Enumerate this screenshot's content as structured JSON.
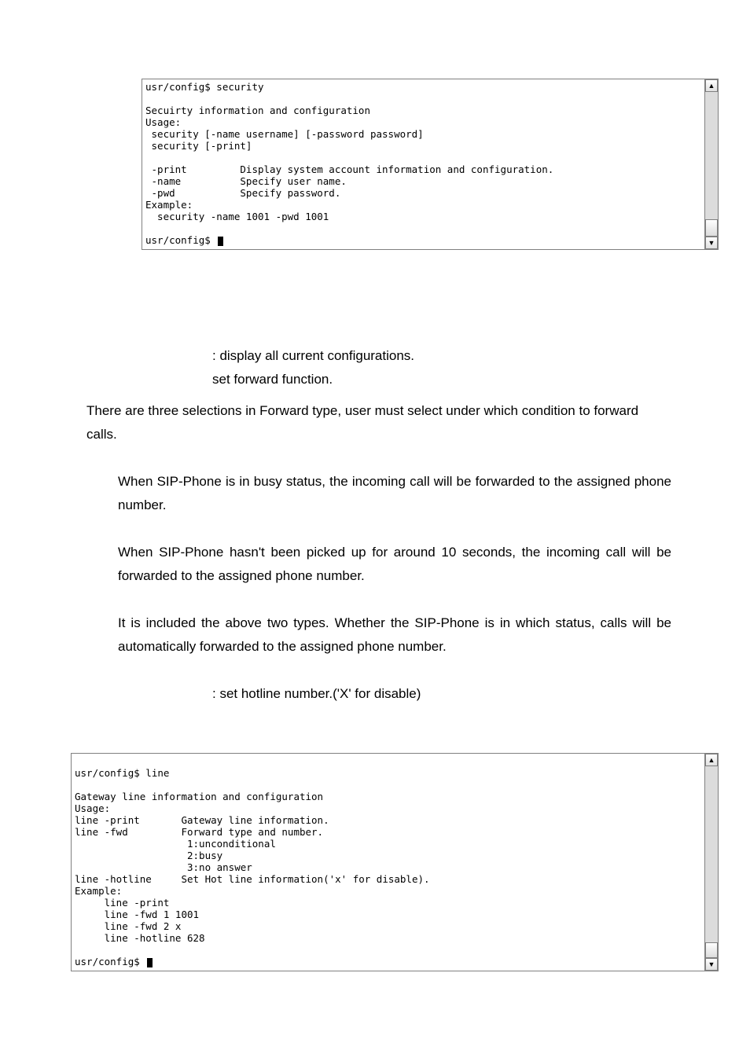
{
  "terminal1": {
    "text": "usr/config$ security\n\nSecuirty information and configuration\nUsage:\n security [-name username] [-password password]\n security [-print]\n\n -print         Display system account information and configuration.\n -name          Specify user name.\n -pwd           Specify password.\nExample:\n  security -name 1001 -pwd 1001\n\nusr/config$ "
  },
  "terminal2": {
    "text": "\nusr/config$ line\n\nGateway line information and configuration\nUsage:\nline -print       Gateway line information.\nline -fwd         Forward type and number.\n                   1:unconditional\n                   2:busy\n                   3:no answer\nline -hotline     Set Hot line information('x' for disable).\nExample:\n     line -print\n     line -fwd 1 1001\n     line -fwd 2 x\n     line -hotline 628\n\nusr/config$ "
  },
  "def1": ": display all current configurations.",
  "def2": " set forward function.",
  "para1": "There are three selections in Forward type, user must select under which condition to forward calls.",
  "busy": "When SIP-Phone is in busy status, the incoming call will be forwarded to the assigned phone number.",
  "noanswer": "When SIP-Phone hasn't been picked up for around 10 seconds, the incoming call will be forwarded to the assigned phone number.",
  "uncond": "It is included the above two types. Whether the SIP-Phone is in which status, calls will be automatically forwarded to the assigned phone number.",
  "hotline": ": set hotline number.('X' for disable)",
  "scroll": {
    "up": "▲",
    "down": "▼"
  }
}
